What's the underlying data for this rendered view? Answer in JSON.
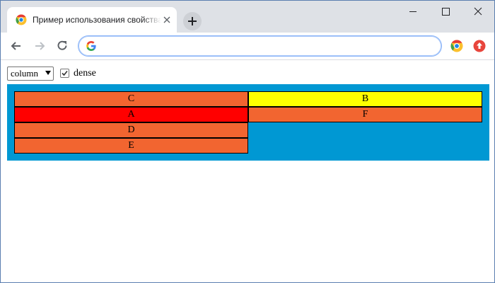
{
  "browser": {
    "tab_title": "Пример использования свойства grid-auto-flow",
    "omnibox_value": "",
    "icons": {
      "favicon": "chromium-icon",
      "close": "close-icon",
      "newtab": "plus-icon",
      "back": "back-arrow-icon",
      "forward": "forward-arrow-icon",
      "reload": "reload-icon",
      "omnibox": "google-g-icon",
      "ext1": "chromium-extension-icon",
      "ext2": "update-icon"
    },
    "window_buttons": [
      "minimize-icon",
      "maximize-icon",
      "close-window-icon"
    ]
  },
  "controls": {
    "select_value": "column",
    "checkbox_checked": true,
    "checkbox_label": "dense"
  },
  "grid": {
    "background": "#0098d3",
    "items": [
      {
        "label": "C",
        "color": "#f26530"
      },
      {
        "label": "B",
        "color": "#ffff00"
      },
      {
        "label": "A",
        "color": "#ff0000"
      },
      {
        "label": "F",
        "color": "#f26530"
      },
      {
        "label": "D",
        "color": "#f26530"
      },
      {
        "label": "E",
        "color": "#f26530"
      }
    ]
  }
}
